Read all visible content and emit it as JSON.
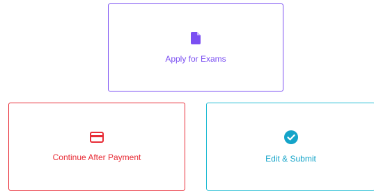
{
  "colors": {
    "apply_accent": "#7b4ff2",
    "continue_accent": "#e82c36",
    "edit_label": "#14a4c9",
    "edit_border": "#22bcd4"
  },
  "cards": {
    "apply": {
      "label": "Apply for Exams",
      "icon": "document-icon"
    },
    "continue": {
      "label": "Continue After Payment",
      "icon": "credit-card-icon"
    },
    "edit": {
      "label": "Edit & Submit",
      "icon": "check-circle-icon"
    }
  }
}
